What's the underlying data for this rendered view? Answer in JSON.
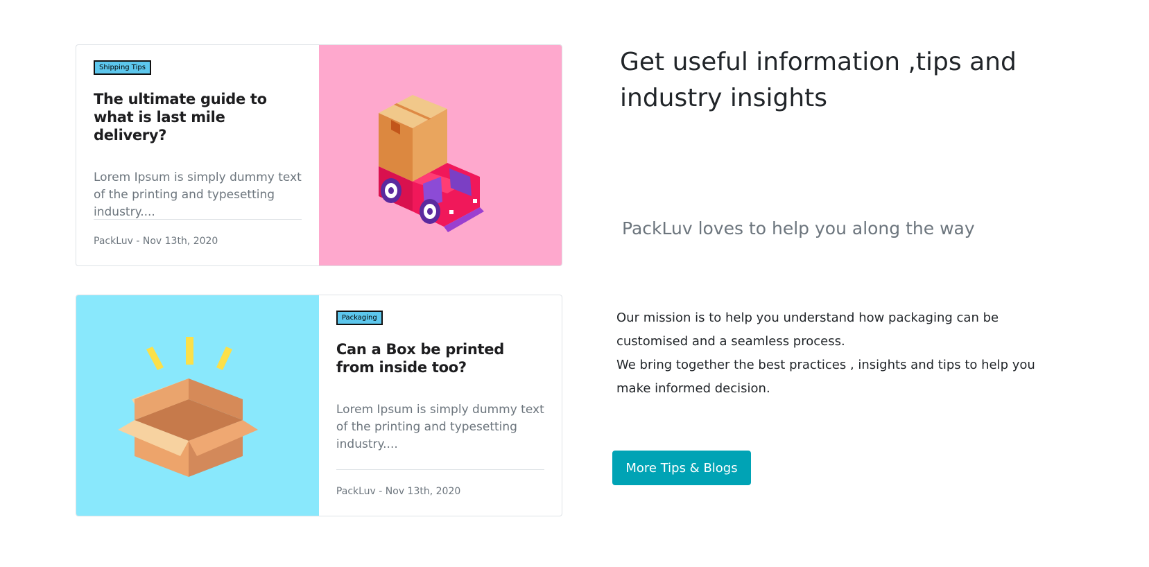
{
  "posts": [
    {
      "category": "Shipping Tips",
      "title": "The ultimate guide to what is last mile delivery?",
      "excerpt": "Lorem Ipsum is simply dummy text of the printing and typesetting industry....",
      "meta": "PackLuv - Nov 13th, 2020",
      "image_icon": "delivery-truck-illustration",
      "image_bg": "#fea8cd"
    },
    {
      "category": "Packaging",
      "title": "Can a Box be printed from inside too?",
      "excerpt": "Lorem Ipsum is simply dummy text of the printing and typesetting industry....",
      "meta": "PackLuv - Nov 13th, 2020",
      "image_icon": "open-box-illustration",
      "image_bg": "#89e8fc"
    }
  ],
  "info": {
    "headline": "Get useful information ,tips and industry insights",
    "subheadline": "PackLuv loves to help you along the way",
    "mission_line1": "Our mission is to help you understand how packaging can be customised and a seamless process.",
    "mission_line2": "We bring together the best practices , insights and tips to help you make informed decision.",
    "cta_label": "More Tips & Blogs"
  },
  "colors": {
    "accent": "#00a3b5",
    "badge": "#5dc7ed"
  }
}
